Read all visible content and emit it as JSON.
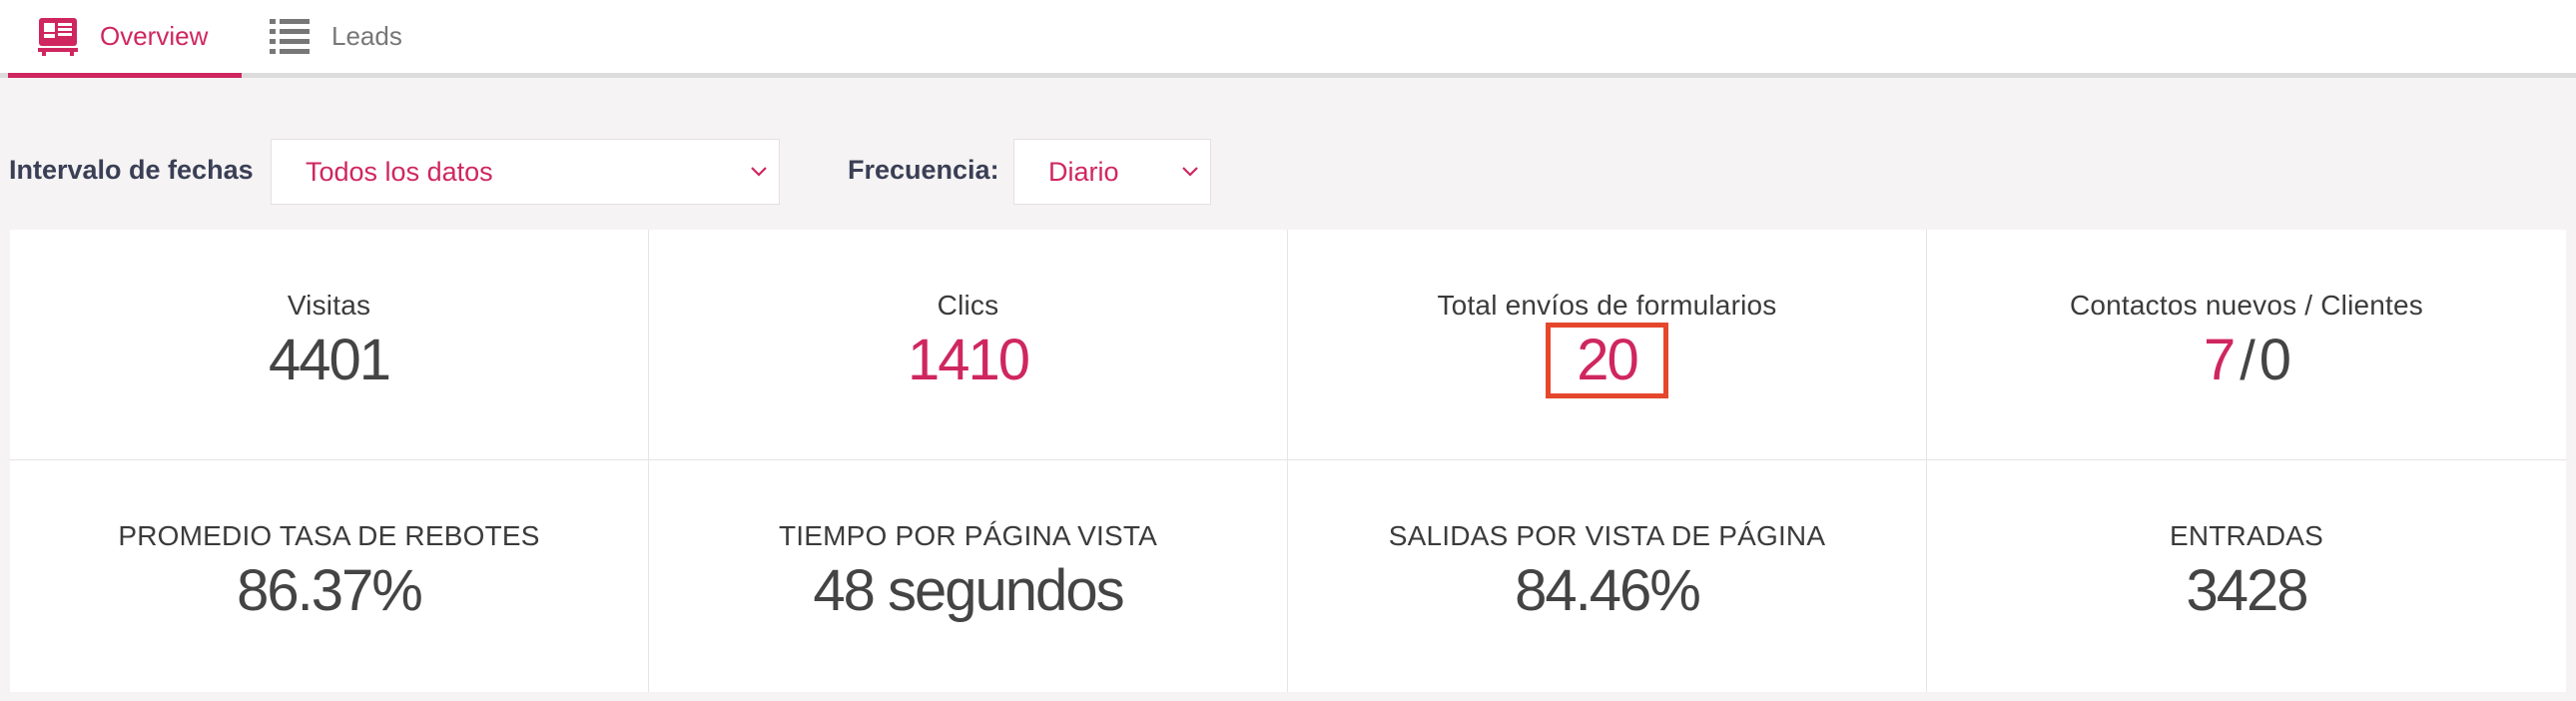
{
  "tabs": [
    {
      "label": "Overview",
      "icon": "dashboard-icon",
      "active": true
    },
    {
      "label": "Leads",
      "icon": "list-icon",
      "active": false
    }
  ],
  "filters": {
    "date_range_label": "Intervalo de fechas",
    "date_range_value": "Todos los datos",
    "frequency_label": "Frecuencia:",
    "frequency_value": "Diario"
  },
  "stats": {
    "visits": {
      "label": "Visitas",
      "value": "4401"
    },
    "clicks": {
      "label": "Clics",
      "value": "1410"
    },
    "form_submissions": {
      "label": "Total envíos de formularios",
      "value": "20"
    },
    "contacts_clients": {
      "label": "Contactos nuevos / Clientes",
      "contacts": "7",
      "separator": "/",
      "clients": "0"
    },
    "bounce_rate": {
      "label": "PROMEDIO TASA DE REBOTES",
      "value": "86.37%"
    },
    "time_per_page": {
      "label": "TIEMPO POR PÁGINA VISTA",
      "value": "48 segundos"
    },
    "exits_per_page": {
      "label": "SALIDAS POR VISTA DE PÁGINA",
      "value": "84.46%"
    },
    "entries": {
      "label": "ENTRADAS",
      "value": "3428"
    }
  },
  "colors": {
    "accent": "#cf2660",
    "highlight_border": "#e5472c",
    "text": "#444444"
  }
}
